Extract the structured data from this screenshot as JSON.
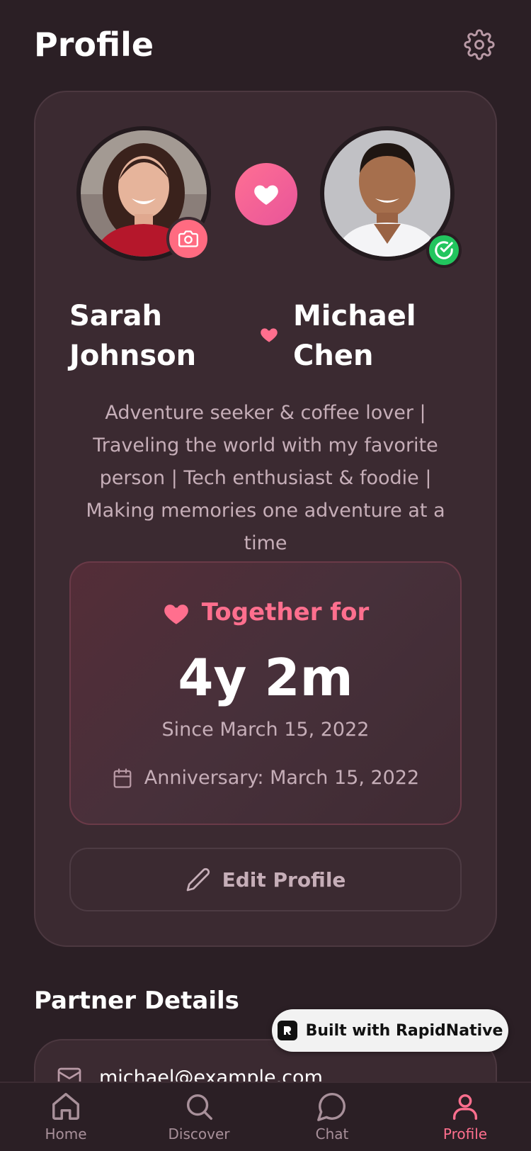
{
  "header": {
    "title": "Profile",
    "settings_icon": "gear-icon"
  },
  "couple": {
    "partner1": {
      "name": "Sarah Johnson",
      "photo_badge_icon": "camera-icon"
    },
    "partner2": {
      "name": "Michael Chen",
      "verified_icon": "check-circle-icon"
    },
    "bio": "Adventure seeker & coffee lover    |  Traveling the world with my favorite person    | Tech enthusiast & foodie    |  Making memories one adventure at a time"
  },
  "together": {
    "label": "Together for",
    "duration": "4y 2m",
    "since": "Since March 15, 2022",
    "anniversary": "Anniversary: March 15, 2022"
  },
  "edit_button": {
    "label": "Edit Profile"
  },
  "partner_details": {
    "title": "Partner Details",
    "email": "michael@example.com"
  },
  "badge": {
    "label": "Built with RapidNative"
  },
  "nav": {
    "items": [
      {
        "label": "Home",
        "icon": "home-icon",
        "active": false
      },
      {
        "label": "Discover",
        "icon": "search-icon",
        "active": false
      },
      {
        "label": "Chat",
        "icon": "chat-icon",
        "active": false
      },
      {
        "label": "Profile",
        "icon": "user-icon",
        "active": true
      }
    ]
  },
  "colors": {
    "accent": "#ff6f8e",
    "background": "#2b1f25",
    "card": "#3b2a31",
    "verified": "#22c55e"
  }
}
